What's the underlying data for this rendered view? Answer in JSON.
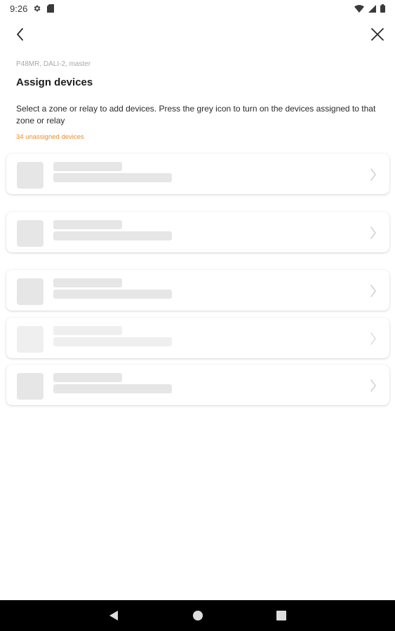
{
  "status_bar": {
    "time": "9:26",
    "icons": [
      "gear-icon",
      "sd-card-icon",
      "wifi-icon",
      "signal-icon",
      "battery-icon"
    ]
  },
  "app_bar": {
    "back_icon": "chevron-left-icon",
    "close_icon": "close-icon"
  },
  "header": {
    "device_path": "P48MR, DALI-2, master",
    "title": "Assign devices",
    "description": "Select a zone or relay to add devices. Press the grey icon to turn on the devices assigned to that zone or relay",
    "unassigned_count": "34 unassigned devices"
  },
  "list": {
    "state": "loading",
    "placeholder_count": 5
  },
  "nav_bar": {
    "icons": [
      "back-triangle-icon",
      "home-circle-icon",
      "recents-square-icon"
    ]
  },
  "colors": {
    "accent": "#f08a24",
    "skeleton": "#e6e6e6",
    "nav_background": "#000000"
  }
}
